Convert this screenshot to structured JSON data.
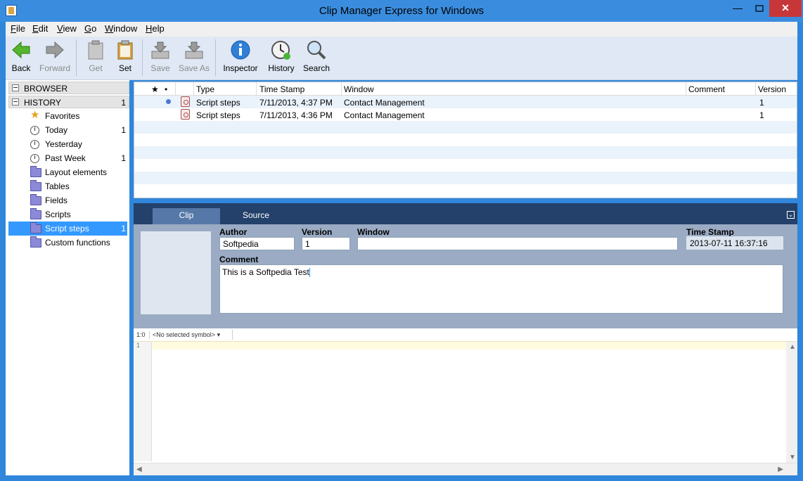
{
  "window": {
    "title": "Clip Manager Express for Windows",
    "minimize": "—",
    "maximize": "",
    "close": "✕"
  },
  "menu": [
    {
      "mn": "F",
      "rest": "ile"
    },
    {
      "mn": "E",
      "rest": "dit"
    },
    {
      "mn": "V",
      "rest": "iew"
    },
    {
      "mn": "G",
      "rest": "o"
    },
    {
      "mn": "W",
      "rest": "indow"
    },
    {
      "mn": "H",
      "rest": "elp"
    }
  ],
  "toolbar": {
    "back": "Back",
    "forward": "Forward",
    "get": "Get",
    "set": "Set",
    "save": "Save",
    "save_as": "Save As",
    "inspector": "Inspector",
    "history": "History",
    "search": "Search"
  },
  "sidebar": {
    "browser": {
      "label": "BROWSER"
    },
    "history": {
      "label": "HISTORY",
      "count": "1"
    },
    "items": [
      {
        "label": "Favorites",
        "count": "",
        "icon": "star-icon"
      },
      {
        "label": "Today",
        "count": "1",
        "icon": "clock-icon"
      },
      {
        "label": "Yesterday",
        "count": "",
        "icon": "clock-icon"
      },
      {
        "label": "Past Week",
        "count": "1",
        "icon": "clock-icon"
      },
      {
        "label": "Layout elements",
        "count": "",
        "icon": "folder-icon"
      },
      {
        "label": "Tables",
        "count": "",
        "icon": "folder-icon"
      },
      {
        "label": "Fields",
        "count": "",
        "icon": "folder-icon"
      },
      {
        "label": "Scripts",
        "count": "",
        "icon": "folder-icon"
      },
      {
        "label": "Script steps",
        "count": "1",
        "icon": "folder-icon",
        "selected": true
      },
      {
        "label": "Custom functions",
        "count": "",
        "icon": "folder-icon"
      }
    ]
  },
  "list": {
    "headers": {
      "star": "★",
      "dot": "•",
      "type": "Type",
      "timestamp": "Time Stamp",
      "window": "Window",
      "comment": "Comment",
      "version": "Version"
    },
    "rows": [
      {
        "type": "Script steps",
        "timestamp": "7/11/2013, 4:37 PM",
        "window": "Contact Management",
        "comment": "",
        "version": "1",
        "current": true
      },
      {
        "type": "Script steps",
        "timestamp": "7/11/2013, 4:36 PM",
        "window": "Contact Management",
        "comment": "",
        "version": "1",
        "current": false
      }
    ]
  },
  "detail": {
    "tabs": [
      "Clip",
      "Source"
    ],
    "active_tab": "Clip",
    "collapse": "⌄",
    "author_label": "Author",
    "author": "Softpedia",
    "version_label": "Version",
    "version": "1",
    "window_label": "Window",
    "window": "",
    "timestamp_label": "Time Stamp",
    "timestamp": "2013-07-11 16:37:16",
    "comment_label": "Comment",
    "comment": "This is a Softpedia Test"
  },
  "editor": {
    "position": "1:0",
    "symbol": "<No selected symbol>",
    "line_number": "1"
  },
  "colors": {
    "accent": "#3399ff",
    "titlebar": "#3a8dde",
    "close": "#c7373a",
    "tab_bar": "#24416b"
  }
}
